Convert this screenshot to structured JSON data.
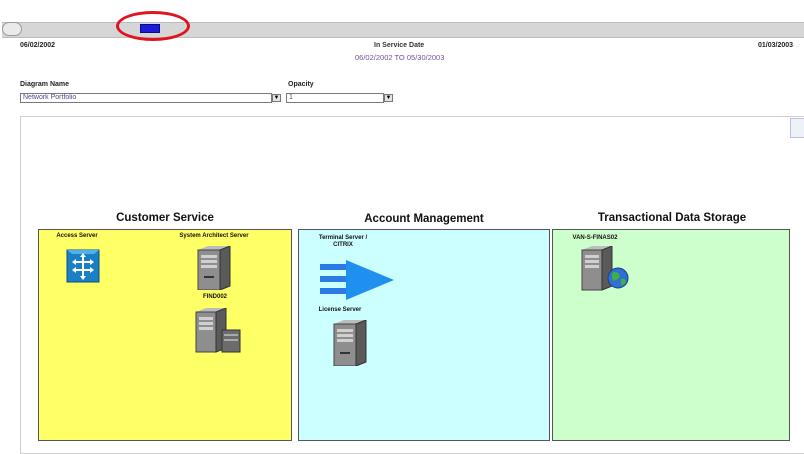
{
  "timeline": {
    "start_date": "06/02/2002",
    "end_date": "01/03/2003",
    "title": "In Service Date",
    "range": "06/02/2002 TO 05/30/2003"
  },
  "controls": {
    "diagram_label": "Diagram Name",
    "diagram_value": "Network Portfolio",
    "opacity_label": "Opacity",
    "opacity_value": "1"
  },
  "groups": [
    {
      "title": "Customer Service",
      "color": "#ffff66",
      "nodes": [
        {
          "label": "Access Server",
          "icon": "switch-icon"
        },
        {
          "label": "System Architect Server",
          "icon": "server-tower-icon"
        },
        {
          "label": "FIND002",
          "icon": "server-storage-icon"
        }
      ]
    },
    {
      "title": "Account Management",
      "color": "#ccffff",
      "nodes": [
        {
          "label": "Terminal Server / CITRIX",
          "icon": "citrix-arrow-icon"
        },
        {
          "label": "License Server",
          "icon": "server-tower-icon"
        }
      ]
    },
    {
      "title": "Transactional Data Storage",
      "color": "#ccffcc",
      "nodes": [
        {
          "label": "VAN-S-FINAS02",
          "icon": "web-server-icon"
        }
      ]
    }
  ],
  "colors": {
    "handle": "#1d1dd6",
    "annotation": "#e0141d"
  }
}
